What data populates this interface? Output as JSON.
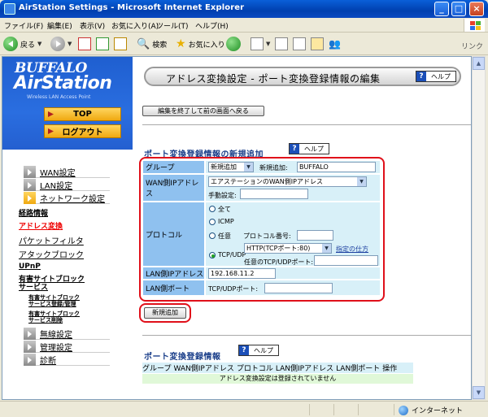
{
  "window": {
    "title": "AirStation Settings - Microsoft Internet Explorer",
    "buttons": [
      "_",
      "□",
      "×"
    ]
  },
  "menubar": [
    "ファイル(F)",
    "編集(E)",
    "表示(V)",
    "お気に入り(A)",
    "ツール(T)",
    "ヘルプ(H)"
  ],
  "toolbar": {
    "back_label": "戻る",
    "search_label": "検索",
    "favorites_label": "お気に入り",
    "links_label": "リンク"
  },
  "statusbar": {
    "zone": "インターネット"
  },
  "sidebar": {
    "brand": "BUFFALO",
    "product": "AirStation",
    "tagline": "Wireless LAN Access Point",
    "top_button": "TOP",
    "logout_button": "ログアウト",
    "menu": {
      "wan": "WAN設定",
      "lan": "LAN設定",
      "network": "ネットワーク設定",
      "routing": "経路情報",
      "address_conv": "アドレス変換",
      "packet_filter": "パケットフィルタ",
      "attack_block": "アタックブロック",
      "upnp": "UPnP",
      "harmful_1": "有害サイトブロック",
      "harmful_2": "サービス",
      "harmful_sub1_a": "有害サイトブロック",
      "harmful_sub1_b": "サービス登録/管理",
      "harmful_sub2_a": "有害サイトブロック",
      "harmful_sub2_b": "サービス削除",
      "wireless": "無線設定",
      "admin": "管理設定",
      "diag": "診断"
    }
  },
  "main": {
    "page_title": "アドレス変換設定 - ポート変換登録情報の編集",
    "help_label": "ヘルプ",
    "help_q": "?",
    "back_button": "編集を終了して前の画面へ戻る",
    "new_section_title": "ポート変換登録情報の新規追加",
    "form": {
      "group_label": "グループ",
      "group_select": "新規追加",
      "group_new_label": "新規追加:",
      "group_new_value": "BUFFALO",
      "wan_ip_label": "WAN側IPアドレス",
      "wan_ip_select": "エアステーションのWAN側IPアドレス",
      "manual_label": "手動設定:",
      "protocol_label": "プロトコル",
      "proto_all": "全て",
      "proto_icmp": "ICMP",
      "proto_any": "任意",
      "proto_num_label": "プロトコル番号:",
      "proto_tcpudp": "TCP/UDP",
      "port_select": "HTTP(TCPポート:80)",
      "port_howto": "指定の仕方",
      "any_port_label": "任意のTCP/UDPポート:",
      "lan_ip_label": "LAN側IPアドレス",
      "lan_ip_value": "192.168.11.2",
      "lan_port_label": "LAN側ポート",
      "lan_port_field_label": "TCP/UDPポート:"
    },
    "add_button": "新規追加",
    "list_section_title": "ポート変換登録情報",
    "list_headers": [
      "グループ",
      "WAN側IPアドレス",
      "プロトコル",
      "LAN側IPアドレス",
      "LAN側ポート",
      "操作"
    ],
    "list_empty": "アドレス変換設定は登録されていません"
  }
}
